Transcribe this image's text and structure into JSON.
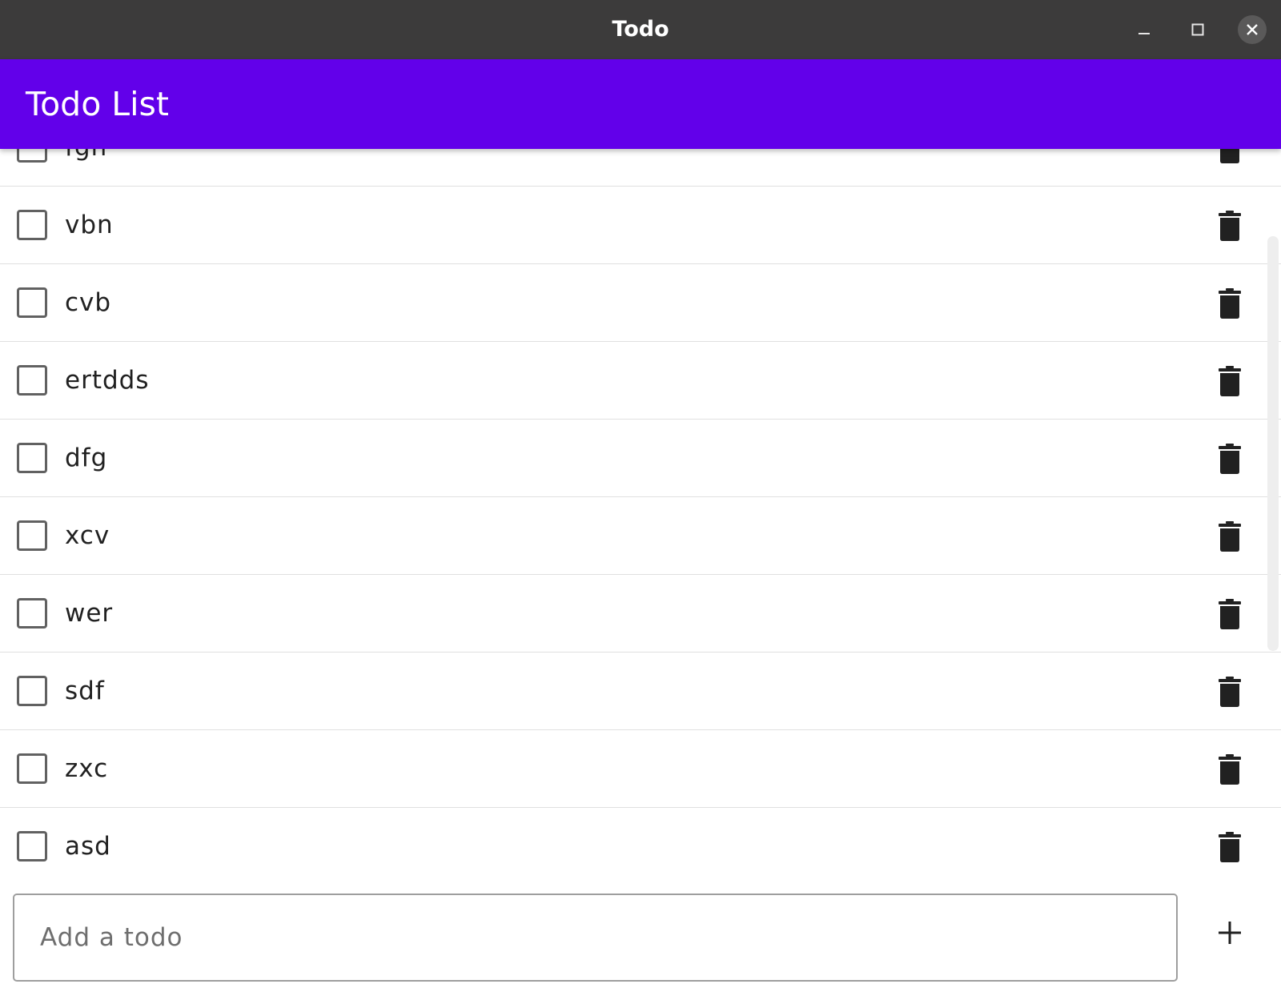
{
  "window": {
    "title": "Todo",
    "controls": [
      "minimize",
      "maximize",
      "close"
    ]
  },
  "appbar": {
    "title": "Todo List",
    "color": "#6200ea"
  },
  "todos": [
    {
      "label": "fgn",
      "checked": false
    },
    {
      "label": "vbn",
      "checked": false
    },
    {
      "label": "cvb",
      "checked": false
    },
    {
      "label": "ertdds",
      "checked": false
    },
    {
      "label": "dfg",
      "checked": false
    },
    {
      "label": "xcv",
      "checked": false
    },
    {
      "label": "wer",
      "checked": false
    },
    {
      "label": "sdf",
      "checked": false
    },
    {
      "label": "zxc",
      "checked": false
    },
    {
      "label": "asd",
      "checked": false
    }
  ],
  "icons": {
    "row_action": "delete-icon",
    "add": "plus-icon"
  },
  "new_todo": {
    "placeholder": "Add a todo",
    "value": ""
  }
}
